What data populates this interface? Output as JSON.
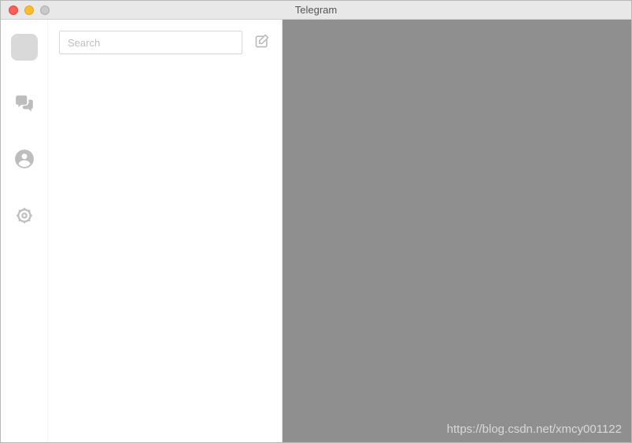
{
  "window": {
    "title": "Telegram"
  },
  "sidebar": {
    "items": [
      {
        "name": "logo"
      },
      {
        "name": "chats"
      },
      {
        "name": "contacts"
      },
      {
        "name": "settings"
      }
    ]
  },
  "search": {
    "placeholder": "Search",
    "value": ""
  },
  "compose_label": "New Message",
  "watermark": "https://blog.csdn.net/xmcy001122"
}
